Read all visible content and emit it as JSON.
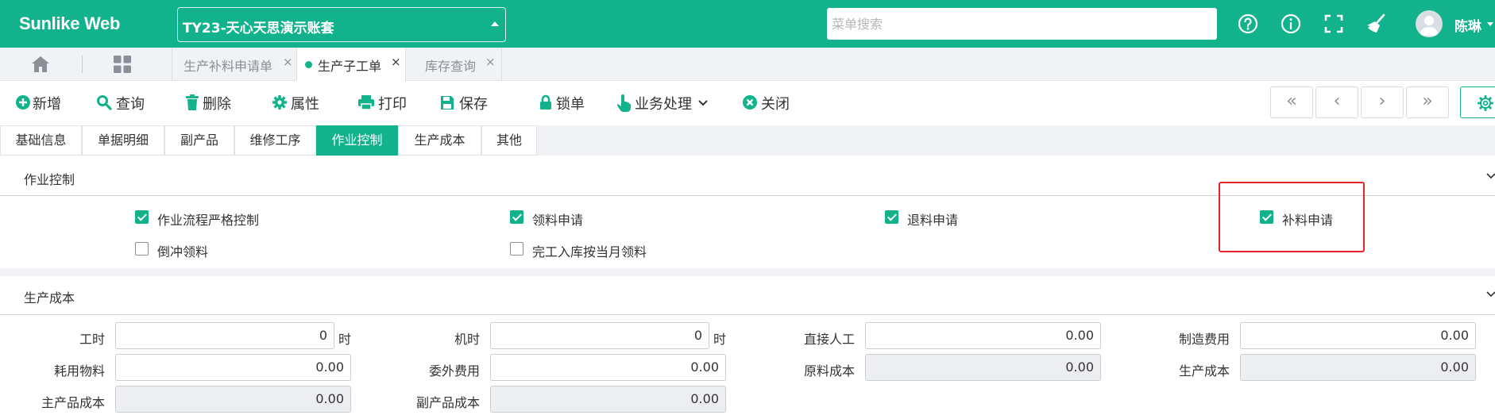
{
  "header": {
    "brand": "Sunlike Web",
    "account": "TY23-天心天思演示账套",
    "search_placeholder": "菜单搜索",
    "user": "陈琳"
  },
  "tabs": [
    {
      "label": "生产补料申请单",
      "close": "×",
      "active": false
    },
    {
      "label": "生产子工单",
      "close": "×",
      "active": true
    },
    {
      "label": "库存查询",
      "close": "×",
      "active": false
    }
  ],
  "toolbar": {
    "new": "新增",
    "query": "查询",
    "delete": "删除",
    "props": "属性",
    "print": "打印",
    "save": "保存",
    "lock": "锁单",
    "business": "业务处理",
    "close": "关闭",
    "nav": {
      "first": "«",
      "prev": "‹",
      "next": "›",
      "last": "»"
    }
  },
  "section_tabs": [
    {
      "label": "基础信息",
      "active": false
    },
    {
      "label": "单据明细",
      "active": false
    },
    {
      "label": "副产品",
      "active": false
    },
    {
      "label": "维修工序",
      "active": false
    },
    {
      "label": "作业控制",
      "active": true
    },
    {
      "label": "生产成本",
      "active": false
    },
    {
      "label": "其他",
      "active": false
    }
  ],
  "job_control": {
    "title": "作业控制",
    "options": [
      {
        "label": "作业流程严格控制",
        "checked": true
      },
      {
        "label": "领料申请",
        "checked": true
      },
      {
        "label": "退料申请",
        "checked": true
      },
      {
        "label": "补料申请",
        "checked": true
      },
      {
        "label": "倒冲领料",
        "checked": false
      },
      {
        "label": "完工入库按当月领料",
        "checked": false
      }
    ]
  },
  "cost": {
    "title": "生产成本",
    "fields": [
      {
        "label": "工时",
        "value": "0",
        "unit": "时",
        "readonly": false
      },
      {
        "label": "机时",
        "value": "0",
        "unit": "时",
        "readonly": false
      },
      {
        "label": "直接人工",
        "value": "0.00",
        "readonly": false
      },
      {
        "label": "制造费用",
        "value": "0.00",
        "readonly": false
      },
      {
        "label": "耗用物料",
        "value": "0.00",
        "readonly": false
      },
      {
        "label": "委外费用",
        "value": "0.00",
        "readonly": false
      },
      {
        "label": "原料成本",
        "value": "0.00",
        "readonly": true
      },
      {
        "label": "生产成本",
        "value": "0.00",
        "readonly": true
      },
      {
        "label": "主产品成本",
        "value": "0.00",
        "readonly": true
      },
      {
        "label": "副产品成本",
        "value": "0.00",
        "readonly": true
      }
    ]
  },
  "colors": {
    "brand": "#12b28c",
    "highlight": "#e8242b"
  }
}
